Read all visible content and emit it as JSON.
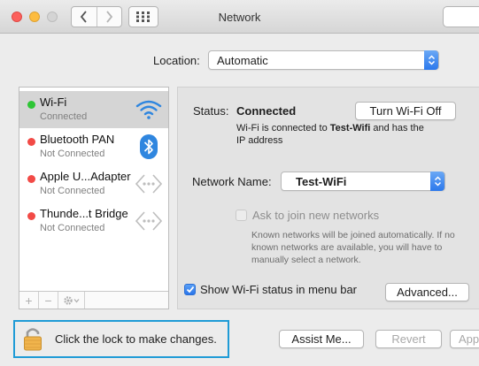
{
  "window": {
    "title": "Network"
  },
  "toolbar": {
    "back_icon": "chevron-left-icon",
    "forward_icon": "chevron-right-icon",
    "grid_icon": "grid-icon"
  },
  "location": {
    "label": "Location:",
    "value": "Automatic"
  },
  "services": [
    {
      "name": "Wi-Fi",
      "status": "Connected",
      "dot": "#2ec535",
      "icon": "wifi-icon",
      "selected": true
    },
    {
      "name": "Bluetooth PAN",
      "status": "Not Connected",
      "dot": "#f24a46",
      "icon": "bluetooth-icon",
      "selected": false
    },
    {
      "name": "Apple U...Adapter",
      "status": "Not Connected",
      "dot": "#f24a46",
      "icon": "ethernet-icon",
      "selected": false
    },
    {
      "name": "Thunde...t Bridge",
      "status": "Not Connected",
      "dot": "#f24a46",
      "icon": "ethernet-icon",
      "selected": false
    }
  ],
  "sidebar_controls": {
    "add": "+",
    "remove": "−"
  },
  "detail": {
    "status_label": "Status:",
    "status_value": "Connected",
    "turn_off_button": "Turn Wi-Fi Off",
    "status_desc_prefix": "Wi-Fi is connected to ",
    "status_desc_network": "Test-Wifi",
    "status_desc_suffix": " and has the",
    "status_desc_line2": "IP address",
    "network_name_label": "Network Name:",
    "network_name_value": "Test-WiFi",
    "ask_join_label": "Ask to join new networks",
    "ask_join_checked": false,
    "ask_join_hint": "Known networks will be joined automatically. If no known networks are available, you will have to manually select a network.",
    "show_status_label": "Show Wi-Fi status in menu bar",
    "show_status_checked": true,
    "advanced_button": "Advanced..."
  },
  "footer": {
    "lock_text": "Click the lock to make changes.",
    "assist_button": "Assist Me...",
    "revert_button": "Revert",
    "apply_button": "Apply"
  },
  "colors": {
    "accent": "#2b78ec",
    "highlight_border": "#1f9bd6",
    "connected": "#2ec535",
    "disconnected": "#f24a46"
  }
}
